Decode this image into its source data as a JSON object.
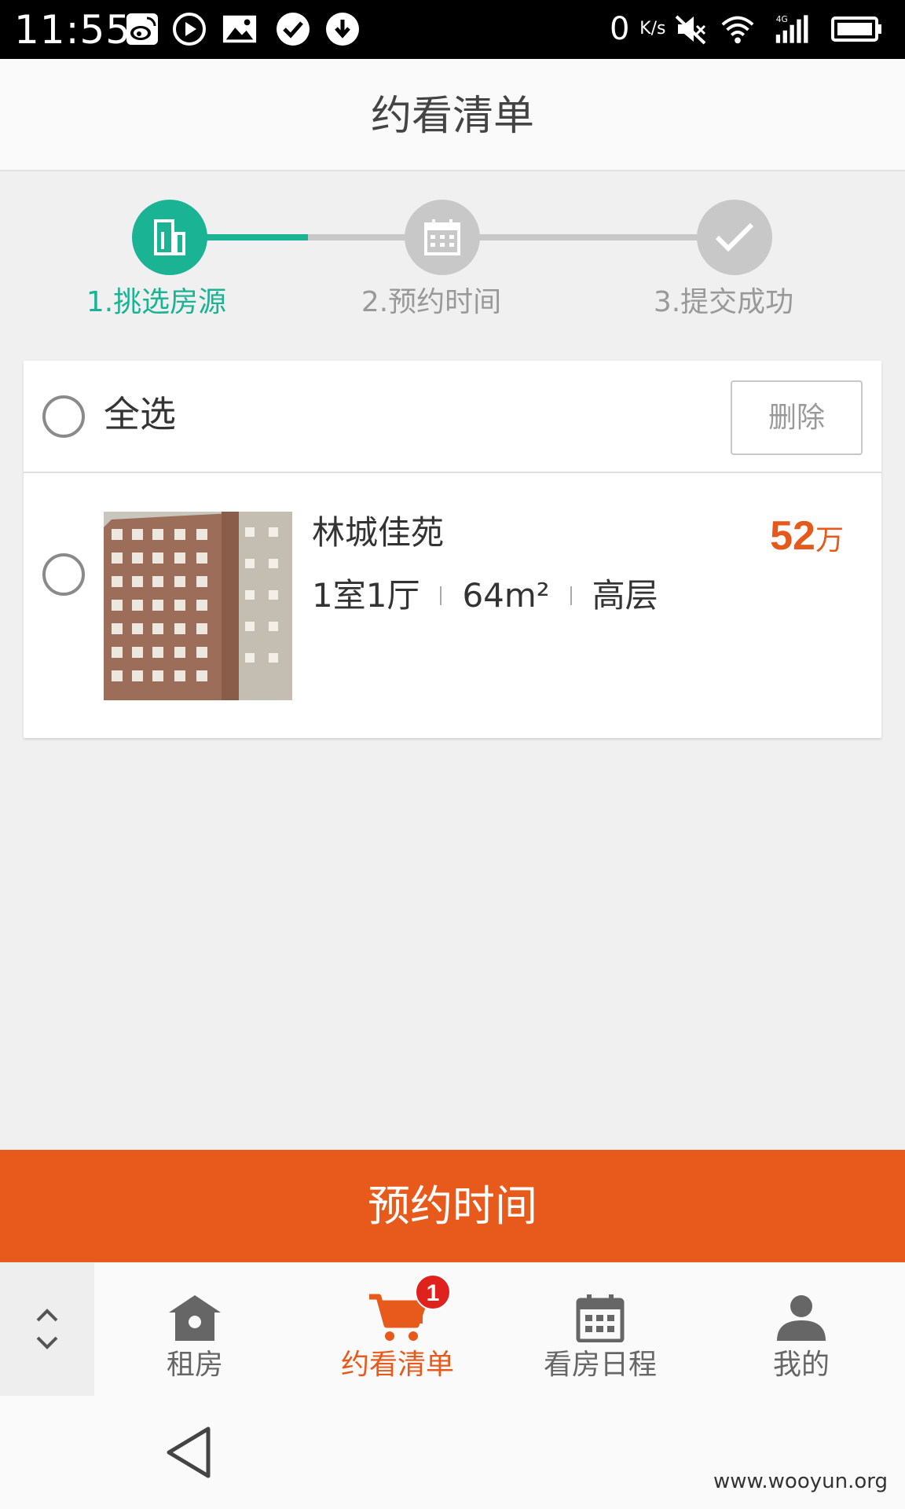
{
  "status_bar": {
    "time": "11:55",
    "net_speed_value": "0",
    "net_speed_unit": "K/s",
    "icons": [
      "weibo-icon",
      "play-icon",
      "image-icon",
      "check-circle-icon",
      "download-icon",
      "mute-icon",
      "wifi-icon",
      "signal-4g-icon",
      "battery-icon"
    ]
  },
  "header": {
    "title": "约看清单"
  },
  "stepper": {
    "steps": [
      {
        "label": "1.挑选房源",
        "icon": "building-icon",
        "state": "active"
      },
      {
        "label": "2.预约时间",
        "icon": "calendar-icon",
        "state": "inactive"
      },
      {
        "label": "3.提交成功",
        "icon": "check-icon",
        "state": "inactive"
      }
    ],
    "active_color": "#1ab394",
    "inactive_color": "#c8c8c8"
  },
  "list": {
    "select_all_label": "全选",
    "delete_label": "删除",
    "items": [
      {
        "name": "林城佳苑",
        "layout": "1室1厅",
        "area": "64m²",
        "floor": "高层",
        "price_value": "52",
        "price_unit": "万"
      }
    ]
  },
  "action": {
    "label": "预约时间",
    "color": "#e85a1b"
  },
  "tabbar": {
    "tabs": [
      {
        "label": "租房",
        "icon": "home-icon",
        "active": false
      },
      {
        "label": "约看清单",
        "icon": "cart-icon",
        "active": true,
        "badge": "1"
      },
      {
        "label": "看房日程",
        "icon": "calendar-icon",
        "active": false
      },
      {
        "label": "我的",
        "icon": "user-icon",
        "active": false
      }
    ],
    "active_color": "#e85a1b"
  },
  "navbar": {
    "watermark": "www.wooyun.org"
  }
}
